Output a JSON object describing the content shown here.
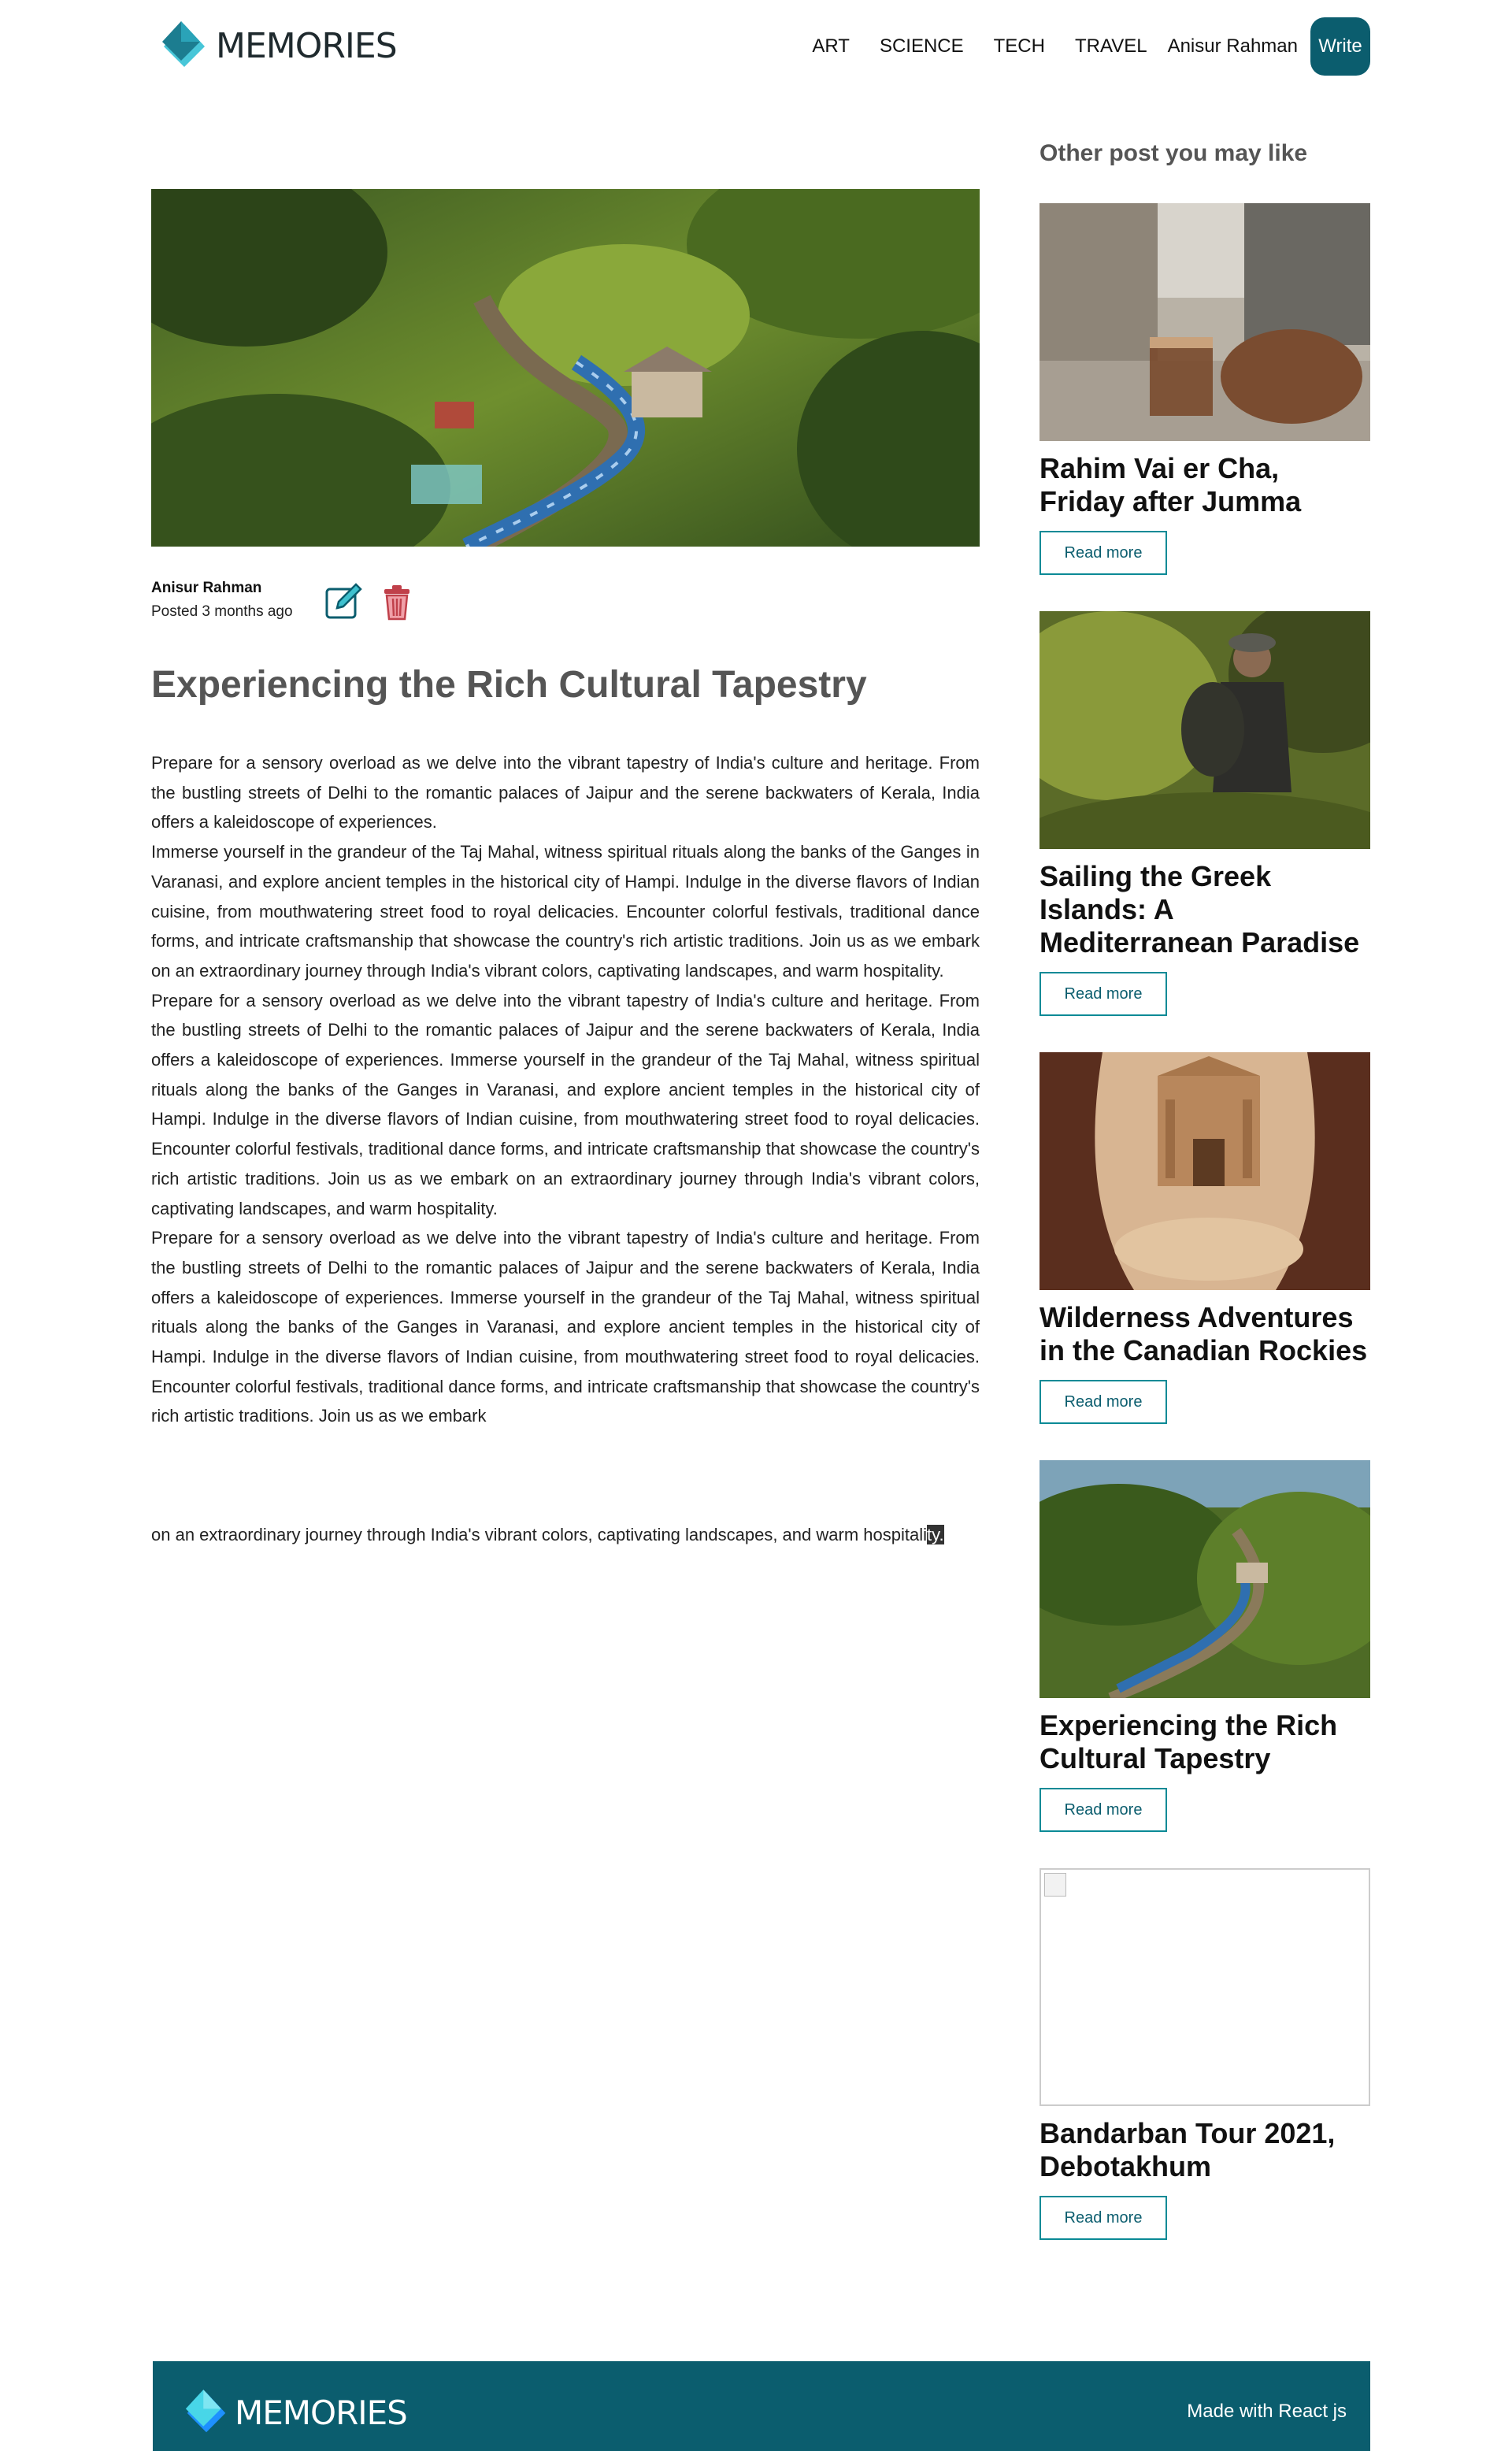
{
  "header": {
    "logo_text": "MEMORIES",
    "nav": [
      "ART",
      "SCIENCE",
      "TECH",
      "TRAVEL"
    ],
    "user": "Anisur Rahman",
    "write_label": "Write"
  },
  "post": {
    "author": "Anisur Rahman",
    "posted": "Posted 3 months ago",
    "title": "Experiencing the Rich Cultural Tapestry",
    "paragraphs": [
      "Prepare for a sensory overload as we delve into the vibrant tapestry of India's culture and heritage. From the bustling streets of Delhi to the romantic palaces of Jaipur and the serene backwaters of Kerala, India offers a kaleidoscope of experiences.",
      "Immerse yourself in the grandeur of the Taj Mahal, witness spiritual rituals along the banks of the Ganges in Varanasi, and explore ancient temples in the historical city of Hampi. Indulge in the diverse flavors of Indian cuisine, from mouthwatering street food to royal delicacies. Encounter colorful festivals, traditional dance forms, and intricate craftsmanship that showcase the country's rich artistic traditions. Join us as we embark on an extraordinary journey through India's vibrant colors, captivating landscapes, and warm hospitality.",
      "Prepare for a sensory overload as we delve into the vibrant tapestry of India's culture and heritage. From the bustling streets of Delhi to the romantic palaces of Jaipur and the serene backwaters of Kerala, India offers a kaleidoscope of experiences. Immerse yourself in the grandeur of the Taj Mahal, witness spiritual rituals along the banks of the Ganges in Varanasi, and explore ancient temples in the historical city of Hampi. Indulge in the diverse flavors of Indian cuisine, from mouthwatering street food to royal delicacies. Encounter colorful festivals, traditional dance forms, and intricate craftsmanship that showcase the country's rich artistic traditions. Join us as we embark on an extraordinary journey through India's vibrant colors, captivating landscapes, and warm hospitality.",
      "Prepare for a sensory overload as we delve into the vibrant tapestry of India's culture and heritage. From the bustling streets of Delhi to the romantic palaces of Jaipur and the serene backwaters of Kerala, India offers a kaleidoscope of experiences. Immerse yourself in the grandeur of the Taj Mahal, witness spiritual rituals along the banks of the Ganges in Varanasi, and explore ancient temples in the historical city of Hampi. Indulge in the diverse flavors of Indian cuisine, from mouthwatering street food to royal delicacies. Encounter colorful festivals, traditional dance forms, and intricate craftsmanship that showcase the country's rich artistic traditions. Join us as we embark"
    ],
    "tail_text": "on an extraordinary journey through India's vibrant colors, captivating landscapes, and warm hospitali",
    "tail_selected": "ty."
  },
  "sidebar": {
    "heading": "Other post you may like",
    "read_more": "Read more",
    "cards": [
      {
        "title": "Rahim Vai er Cha, Friday after Jumma"
      },
      {
        "title": "Sailing the Greek Islands: A Mediterranean Paradise"
      },
      {
        "title": "Wilderness Adventures in the Canadian Rockies"
      },
      {
        "title": "Experiencing the Rich Cultural Tapestry"
      },
      {
        "title": "Bandarban Tour 2021, Debotakhum"
      }
    ]
  },
  "footer": {
    "logo_text": "MEMORIES",
    "made_with": "Made with React js"
  },
  "colors": {
    "brand": "#0b5d6e",
    "title_gray": "#555555",
    "delete_red": "#c0404a"
  }
}
